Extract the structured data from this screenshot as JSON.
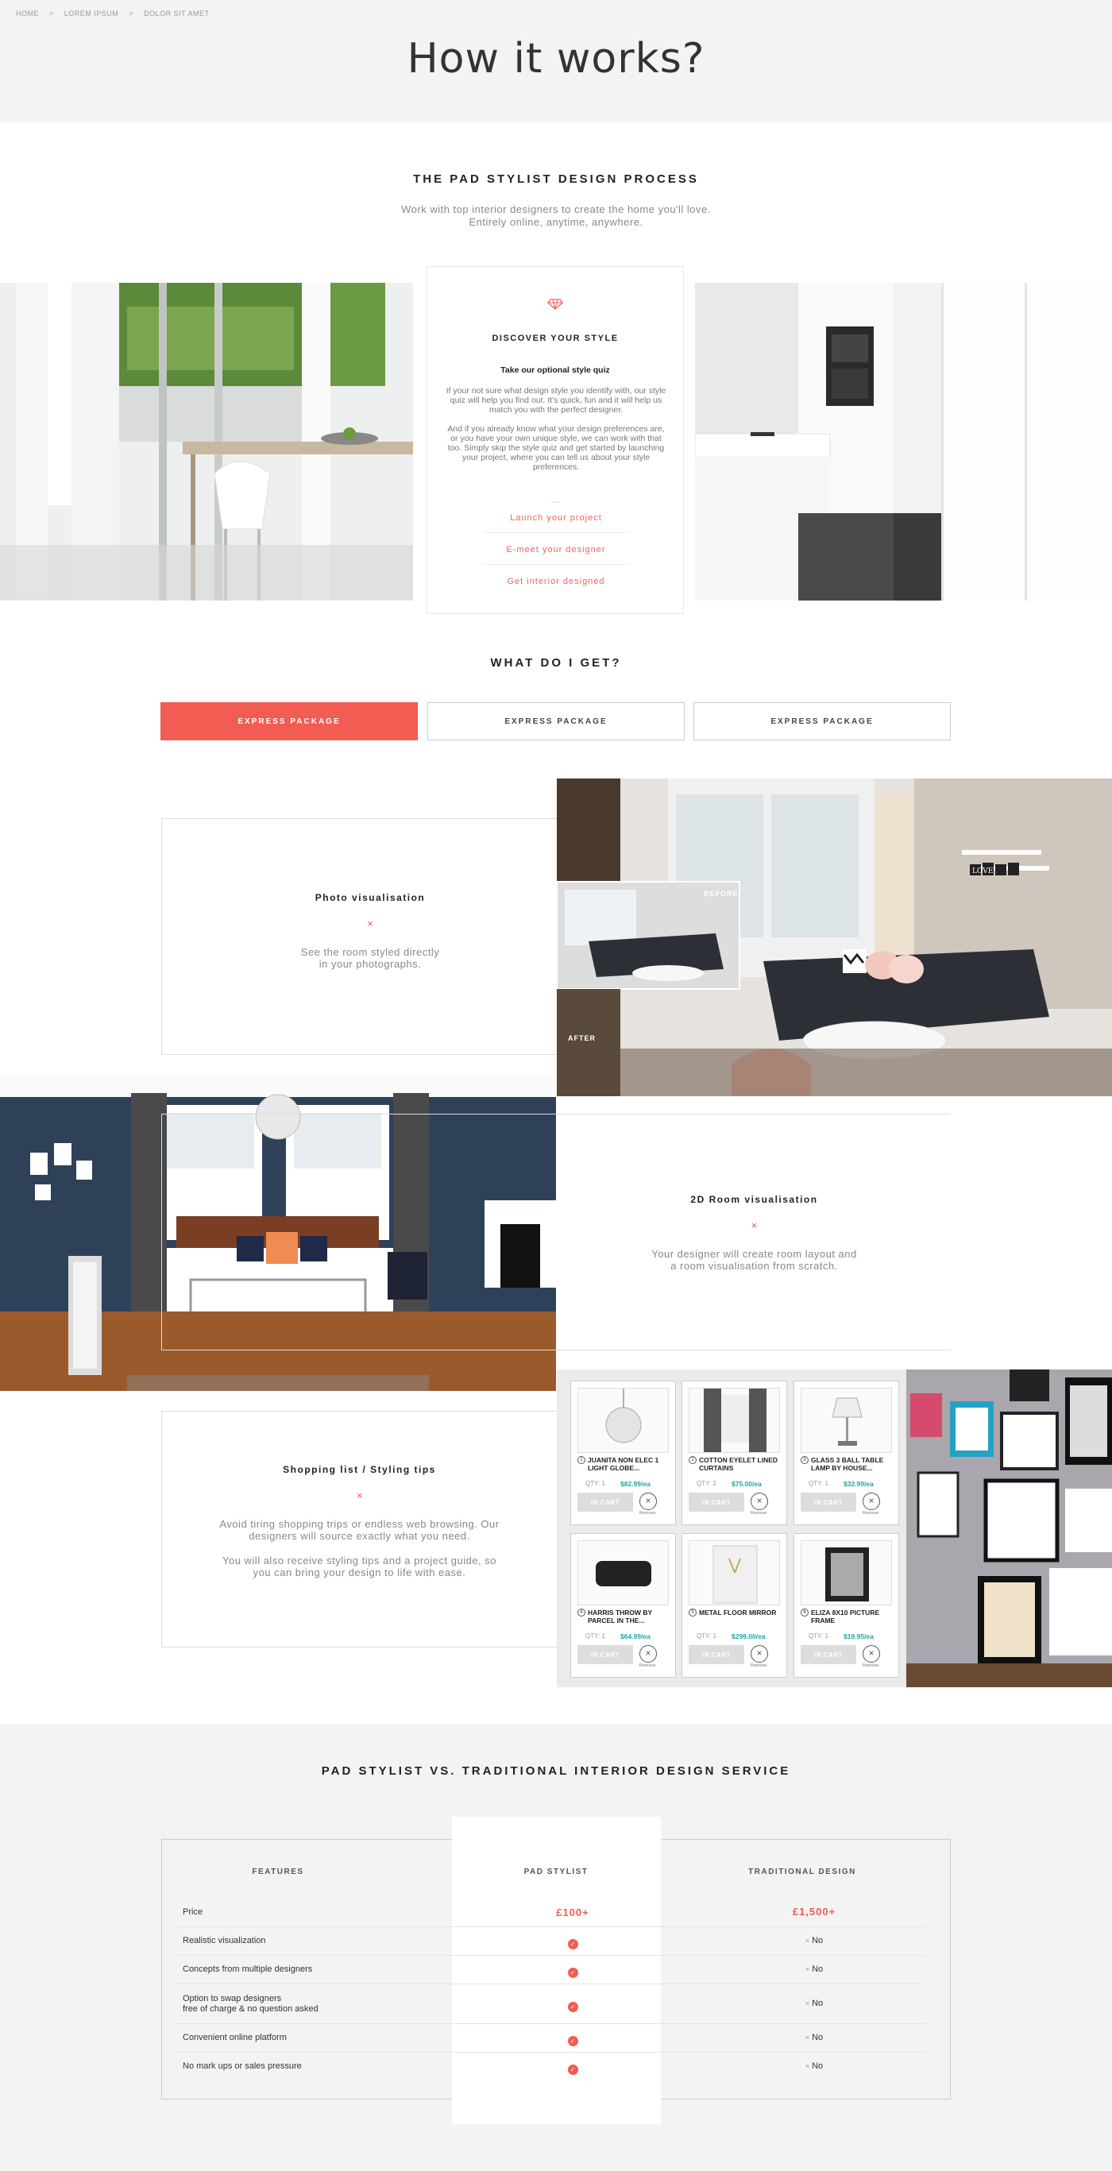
{
  "breadcrumb": [
    "HOME",
    ">",
    "LOREM IPSUM",
    ">",
    "DOLOR SIT AMET"
  ],
  "page_title": "How it works?",
  "process": {
    "title": "THE PAD STYLIST DESIGN PROCESS",
    "subtitle_1": "Work with top interior designers to create the home you'll love.",
    "subtitle_2": "Entirely online, anytime, anywhere.",
    "card": {
      "heading": "DISCOVER YOUR STYLE",
      "subheading": "Take our optional style quiz",
      "para_1": "If your not sure what design style you identify with, our style quiz will help you find out. It's quick, fun and it will help us match you with the perfect designer.",
      "para_2": "And if you already know what your design preferences are, or you have your own unique style, we can work with that too. Simply skip the style quiz and get started by launching your project, where you can tell us about your style preferences.",
      "dash": "—",
      "link_1": "Launch your project",
      "link_2": "E-meet your designer",
      "link_3": "Get interior designed"
    }
  },
  "packages": {
    "title": "WHAT DO I GET?",
    "tab_1": "EXPRESS PACKAGE",
    "tab_2": "EXPRESS PACKAGE",
    "tab_3": "EXPRESS PACKAGE"
  },
  "features": {
    "photo": {
      "title": "Photo visualisation",
      "x": "×",
      "line_1": "See the room styled directly",
      "line_2": "in your photographs.",
      "before": "BEFORE",
      "after": "AFTER",
      "sign": "LOVE"
    },
    "room2d": {
      "title": "2D Room visualisation",
      "x": "×",
      "line_1": "Your designer will create room layout and",
      "line_2": "a room visualisation from scratch."
    },
    "shopping": {
      "title": "Shopping list / Styling tips",
      "x": "×",
      "line_1": "Avoid tiring shopping trips or endless web browsing. Our",
      "line_2": "designers will source exactly what you need.",
      "line_3": "You will also receive styling tips and a project guide, so",
      "line_4": "you can bring your design to life with ease."
    }
  },
  "products": [
    {
      "num": "1",
      "name": "JUANITA NON ELEC 1 LIGHT GLOBE...",
      "qty": "QTY: 1",
      "price": "$82.99/ea",
      "cart": "IN CART",
      "remove": "Remove"
    },
    {
      "num": "2",
      "name": "COTTON EYELET LINED CURTAINS",
      "qty": "QTY: 2",
      "price": "$75.00/ea",
      "cart": "IN CART",
      "remove": "Remove"
    },
    {
      "num": "3",
      "name": "GLASS 3 BALL TABLE LAMP BY HOUSE...",
      "qty": "QTY: 1",
      "price": "$32.99/ea",
      "cart": "IN CART",
      "remove": "Remove"
    },
    {
      "num": "4",
      "name": "HARRIS THROW BY PARCEL IN THE...",
      "qty": "QTY: 1",
      "price": "$64.99/ea",
      "cart": "IN CART",
      "remove": "Remove"
    },
    {
      "num": "5",
      "name": "METAL FLOOR MIRROR",
      "qty": "QTY: 1",
      "price": "$299.00/ea",
      "cart": "IN CART",
      "remove": "Remove"
    },
    {
      "num": "6",
      "name": "ELIZA 8X10 PICTURE FRAME",
      "qty": "QTY: 1",
      "price": "$19.95/ea",
      "cart": "IN CART",
      "remove": "Remove"
    }
  ],
  "comparison": {
    "title": "PAD STYLIST VS. TRADITIONAL INTERIOR DESIGN SERVICE",
    "col_features": "FEATURES",
    "col_pad": "PAD STYLIST",
    "col_trad": "TRADITIONAL DESIGN",
    "rows": [
      {
        "feature": "Price",
        "pad": "£100+",
        "trad": "£1,500+"
      },
      {
        "feature": "Realistic visualization",
        "pad": "✓",
        "trad": "No"
      },
      {
        "feature": "Concepts from multiple designers",
        "pad": "✓",
        "trad": "No"
      },
      {
        "feature": "Option to swap designers",
        "feature_2": "free of charge & no question asked",
        "pad": "✓",
        "trad": "No"
      },
      {
        "feature": "Convenient online platform",
        "pad": "✓",
        "trad": "No"
      },
      {
        "feature": "No mark ups or sales pressure",
        "pad": "✓",
        "trad": "No"
      }
    ],
    "x_mark": "×"
  },
  "colors": {
    "accent": "#f25c53",
    "teal": "#1ea5a8",
    "grey_bg": "#f3f3f3"
  }
}
